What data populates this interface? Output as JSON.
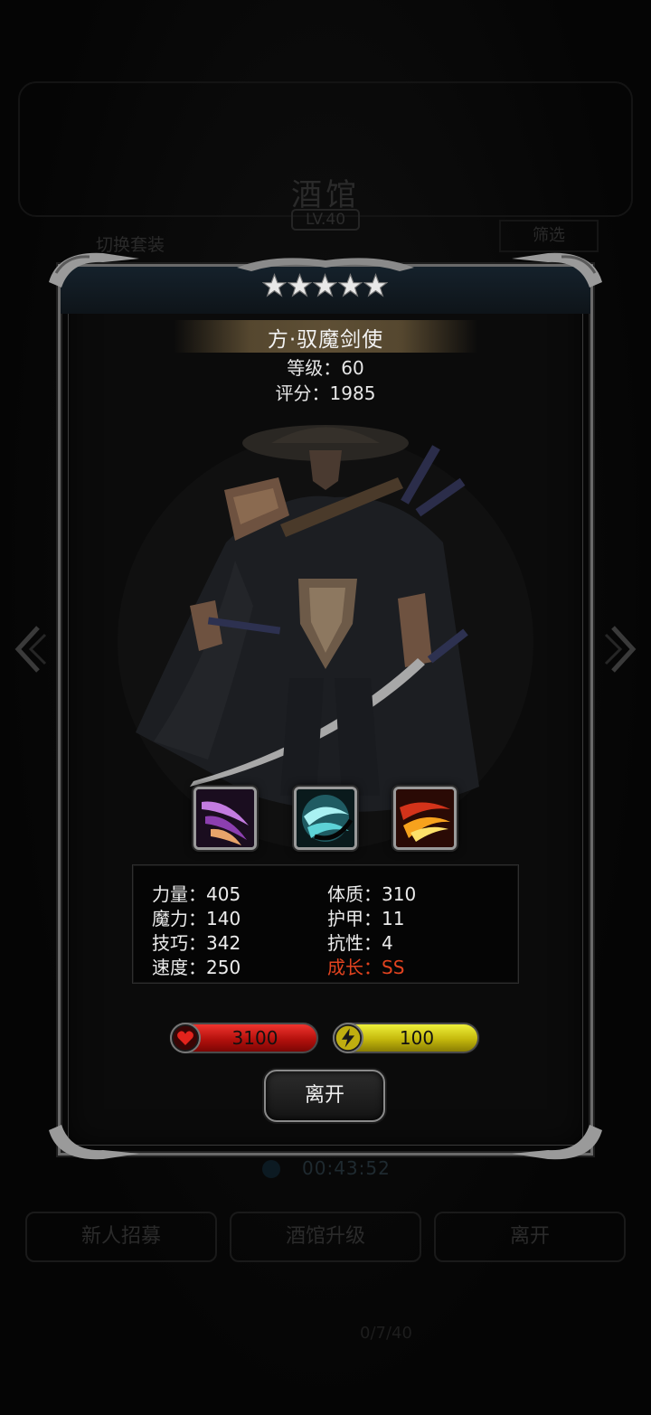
{
  "background": {
    "title": "酒馆",
    "level": "LV.40",
    "switch_outfit": "切换套装",
    "filter": "筛选",
    "timer": "00:43:52",
    "buttons": [
      "新人招募",
      "酒馆升级",
      "离开"
    ],
    "bottom_text": "0/7/40"
  },
  "hero": {
    "stars": 5,
    "name": "方·驭魔剑使",
    "level_text": "等级：60",
    "score_text": "评分：1985"
  },
  "skills": [
    {
      "icon": "purple-slash-skill-icon"
    },
    {
      "icon": "cyan-crescent-skill-icon"
    },
    {
      "icon": "fire-slash-skill-icon"
    }
  ],
  "attributes": {
    "strength": "力量：405",
    "magic": "魔力：140",
    "skill": "技巧：342",
    "speed": "速度：250",
    "constitution": "体质：310",
    "armor": "护甲：11",
    "resistance": "抗性：4",
    "growth": "成长：SS"
  },
  "bars": {
    "hp": "3100",
    "energy": "100"
  },
  "actions": {
    "leave": "离开"
  },
  "colors": {
    "growth": "#e2431f",
    "hp_bar": "#d0201b",
    "energy_bar": "#d8cf1a"
  }
}
